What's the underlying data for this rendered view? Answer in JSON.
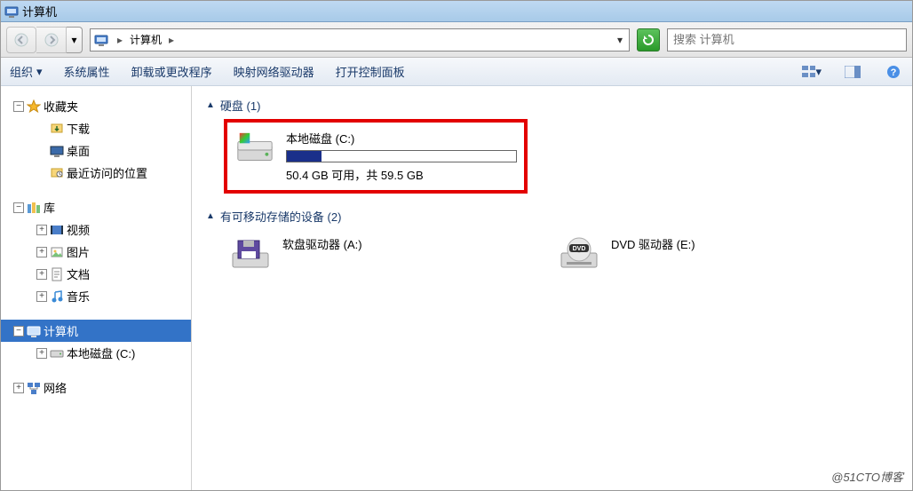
{
  "titlebar": {
    "title": "计算机"
  },
  "navbar": {
    "breadcrumb_label": "计算机",
    "search_placeholder": "搜索 计算机"
  },
  "toolbar": {
    "organize": "组织",
    "properties": "系统属性",
    "uninstall": "卸载或更改程序",
    "map_drive": "映射网络驱动器",
    "control_panel": "打开控制面板"
  },
  "sidebar": {
    "favorites": "收藏夹",
    "downloads": "下载",
    "desktop": "桌面",
    "recent": "最近访问的位置",
    "libraries": "库",
    "videos": "视频",
    "pictures": "图片",
    "documents": "文档",
    "music": "音乐",
    "computer": "计算机",
    "localdisk_c": "本地磁盘 (C:)",
    "network": "网络"
  },
  "content": {
    "group_hdd": "硬盘 (1)",
    "group_removable": "有可移动存储的设备 (2)",
    "drive_c": {
      "name": "本地磁盘 (C:)",
      "detail": "50.4 GB 可用，共 59.5 GB",
      "used_pct": 15
    },
    "floppy": {
      "name": "软盘驱动器 (A:)"
    },
    "dvd": {
      "name": "DVD 驱动器 (E:)"
    }
  },
  "watermark": "@51CTO博客"
}
